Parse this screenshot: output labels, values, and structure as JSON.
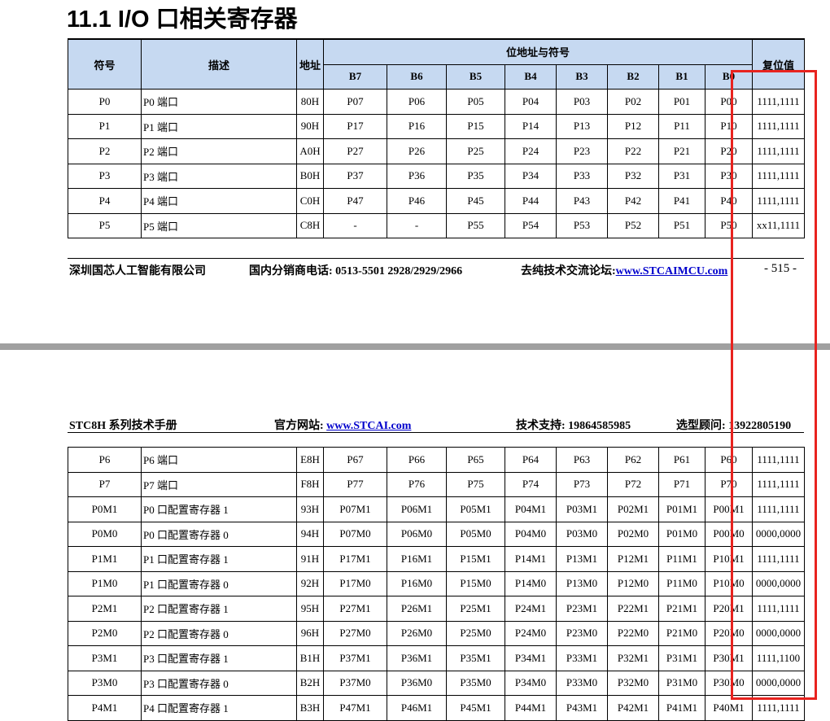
{
  "title": "11.1   I/O 口相关寄存器",
  "table_headers": {
    "symbol": "符号",
    "desc": "描述",
    "addr": "地址",
    "bits_group": "位地址与符号",
    "bits": [
      "B7",
      "B6",
      "B5",
      "B4",
      "B3",
      "B2",
      "B1",
      "B0"
    ],
    "reset": "复位值"
  },
  "table1_rows": [
    [
      "P0",
      "P0 端口",
      "80H",
      "P07",
      "P06",
      "P05",
      "P04",
      "P03",
      "P02",
      "P01",
      "P00",
      "1111,1111"
    ],
    [
      "P1",
      "P1 端口",
      "90H",
      "P17",
      "P16",
      "P15",
      "P14",
      "P13",
      "P12",
      "P11",
      "P10",
      "1111,1111"
    ],
    [
      "P2",
      "P2 端口",
      "A0H",
      "P27",
      "P26",
      "P25",
      "P24",
      "P23",
      "P22",
      "P21",
      "P20",
      "1111,1111"
    ],
    [
      "P3",
      "P3 端口",
      "B0H",
      "P37",
      "P36",
      "P35",
      "P34",
      "P33",
      "P32",
      "P31",
      "P30",
      "1111,1111"
    ],
    [
      "P4",
      "P4 端口",
      "C0H",
      "P47",
      "P46",
      "P45",
      "P44",
      "P43",
      "P42",
      "P41",
      "P40",
      "1111,1111"
    ],
    [
      "P5",
      "P5 端口",
      "C8H",
      "-",
      "-",
      "P55",
      "P54",
      "P53",
      "P52",
      "P51",
      "P50",
      "xx11,1111"
    ]
  ],
  "footer": {
    "company": "深圳国芯人工智能有限公司",
    "phone": "国内分销商电话: 0513-5501 2928/2929/2966",
    "forum_label": "去纯技术交流论坛:",
    "forum_link": "www.STCAIMCU.com",
    "page": "- 515 -"
  },
  "header": {
    "manual": "STC8H 系列技术手册",
    "site_label": "官方网站: ",
    "site_link": "www.STCAI.com",
    "support": "技术支持: 19864585985",
    "advisor": "选型顾问: 13922805190"
  },
  "table2_rows": [
    [
      "P6",
      "P6 端口",
      "E8H",
      "P67",
      "P66",
      "P65",
      "P64",
      "P63",
      "P62",
      "P61",
      "P60",
      "1111,1111"
    ],
    [
      "P7",
      "P7 端口",
      "F8H",
      "P77",
      "P76",
      "P75",
      "P74",
      "P73",
      "P72",
      "P71",
      "P70",
      "1111,1111"
    ],
    [
      "P0M1",
      "P0 口配置寄存器 1",
      "93H",
      "P07M1",
      "P06M1",
      "P05M1",
      "P04M1",
      "P03M1",
      "P02M1",
      "P01M1",
      "P00M1",
      "1111,1111"
    ],
    [
      "P0M0",
      "P0 口配置寄存器 0",
      "94H",
      "P07M0",
      "P06M0",
      "P05M0",
      "P04M0",
      "P03M0",
      "P02M0",
      "P01M0",
      "P00M0",
      "0000,0000"
    ],
    [
      "P1M1",
      "P1 口配置寄存器 1",
      "91H",
      "P17M1",
      "P16M1",
      "P15M1",
      "P14M1",
      "P13M1",
      "P12M1",
      "P11M1",
      "P10M1",
      "1111,1111"
    ],
    [
      "P1M0",
      "P1 口配置寄存器 0",
      "92H",
      "P17M0",
      "P16M0",
      "P15M0",
      "P14M0",
      "P13M0",
      "P12M0",
      "P11M0",
      "P10M0",
      "0000,0000"
    ],
    [
      "P2M1",
      "P2 口配置寄存器 1",
      "95H",
      "P27M1",
      "P26M1",
      "P25M1",
      "P24M1",
      "P23M1",
      "P22M1",
      "P21M1",
      "P20M1",
      "1111,1111"
    ],
    [
      "P2M0",
      "P2 口配置寄存器 0",
      "96H",
      "P27M0",
      "P26M0",
      "P25M0",
      "P24M0",
      "P23M0",
      "P22M0",
      "P21M0",
      "P20M0",
      "0000,0000"
    ],
    [
      "P3M1",
      "P3 口配置寄存器 1",
      "B1H",
      "P37M1",
      "P36M1",
      "P35M1",
      "P34M1",
      "P33M1",
      "P32M1",
      "P31M1",
      "P30M1",
      "1111,1100"
    ],
    [
      "P3M0",
      "P3 口配置寄存器 0",
      "B2H",
      "P37M0",
      "P36M0",
      "P35M0",
      "P34M0",
      "P33M0",
      "P32M0",
      "P31M0",
      "P30M0",
      "0000,0000"
    ],
    [
      "P4M1",
      "P4 口配置寄存器 1",
      "B3H",
      "P47M1",
      "P46M1",
      "P45M1",
      "P44M1",
      "P43M1",
      "P42M1",
      "P41M1",
      "P40M1",
      "1111,1111"
    ]
  ],
  "highlight_color": "#e8231f"
}
